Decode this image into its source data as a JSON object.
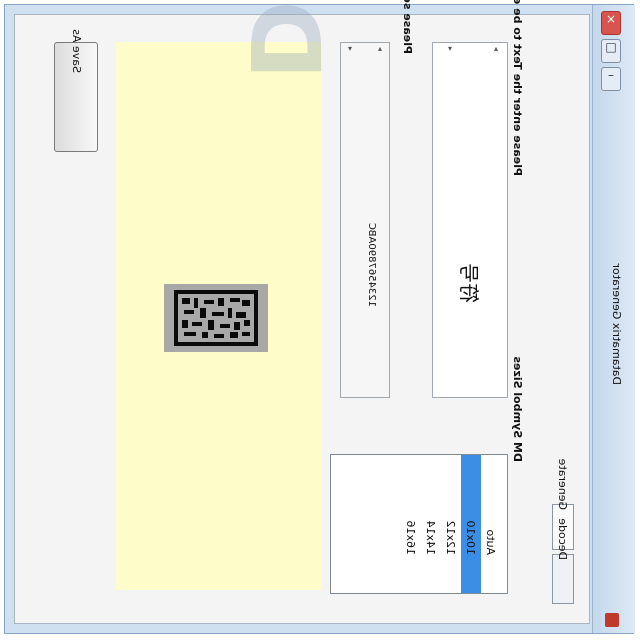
{
  "window": {
    "title": "Datamatrix Generator",
    "icon": "app-icon",
    "controls": [
      "minimize-icon",
      "maximize-icon",
      "close-icon"
    ]
  },
  "tabs": [
    {
      "label": "Generate",
      "active": true
    },
    {
      "label": "Decode",
      "active": false
    }
  ],
  "encode_section": {
    "label": "Please enter the Text to be encoded",
    "value": "符号"
  },
  "format_section": {
    "label": "Please select the Format",
    "value": "1234567890ABC"
  },
  "size_section": {
    "label": "DM Symbol Sizes",
    "options": [
      "Auto",
      "10x10",
      "12x12",
      "14x14",
      "16x16"
    ],
    "selected": "10x10"
  },
  "watermark_text": "Datamatrix",
  "actions": {
    "save_label": "Save As"
  },
  "colors": {
    "yellow_bg": "#fefcc9",
    "selection": "#3a8ee6"
  }
}
